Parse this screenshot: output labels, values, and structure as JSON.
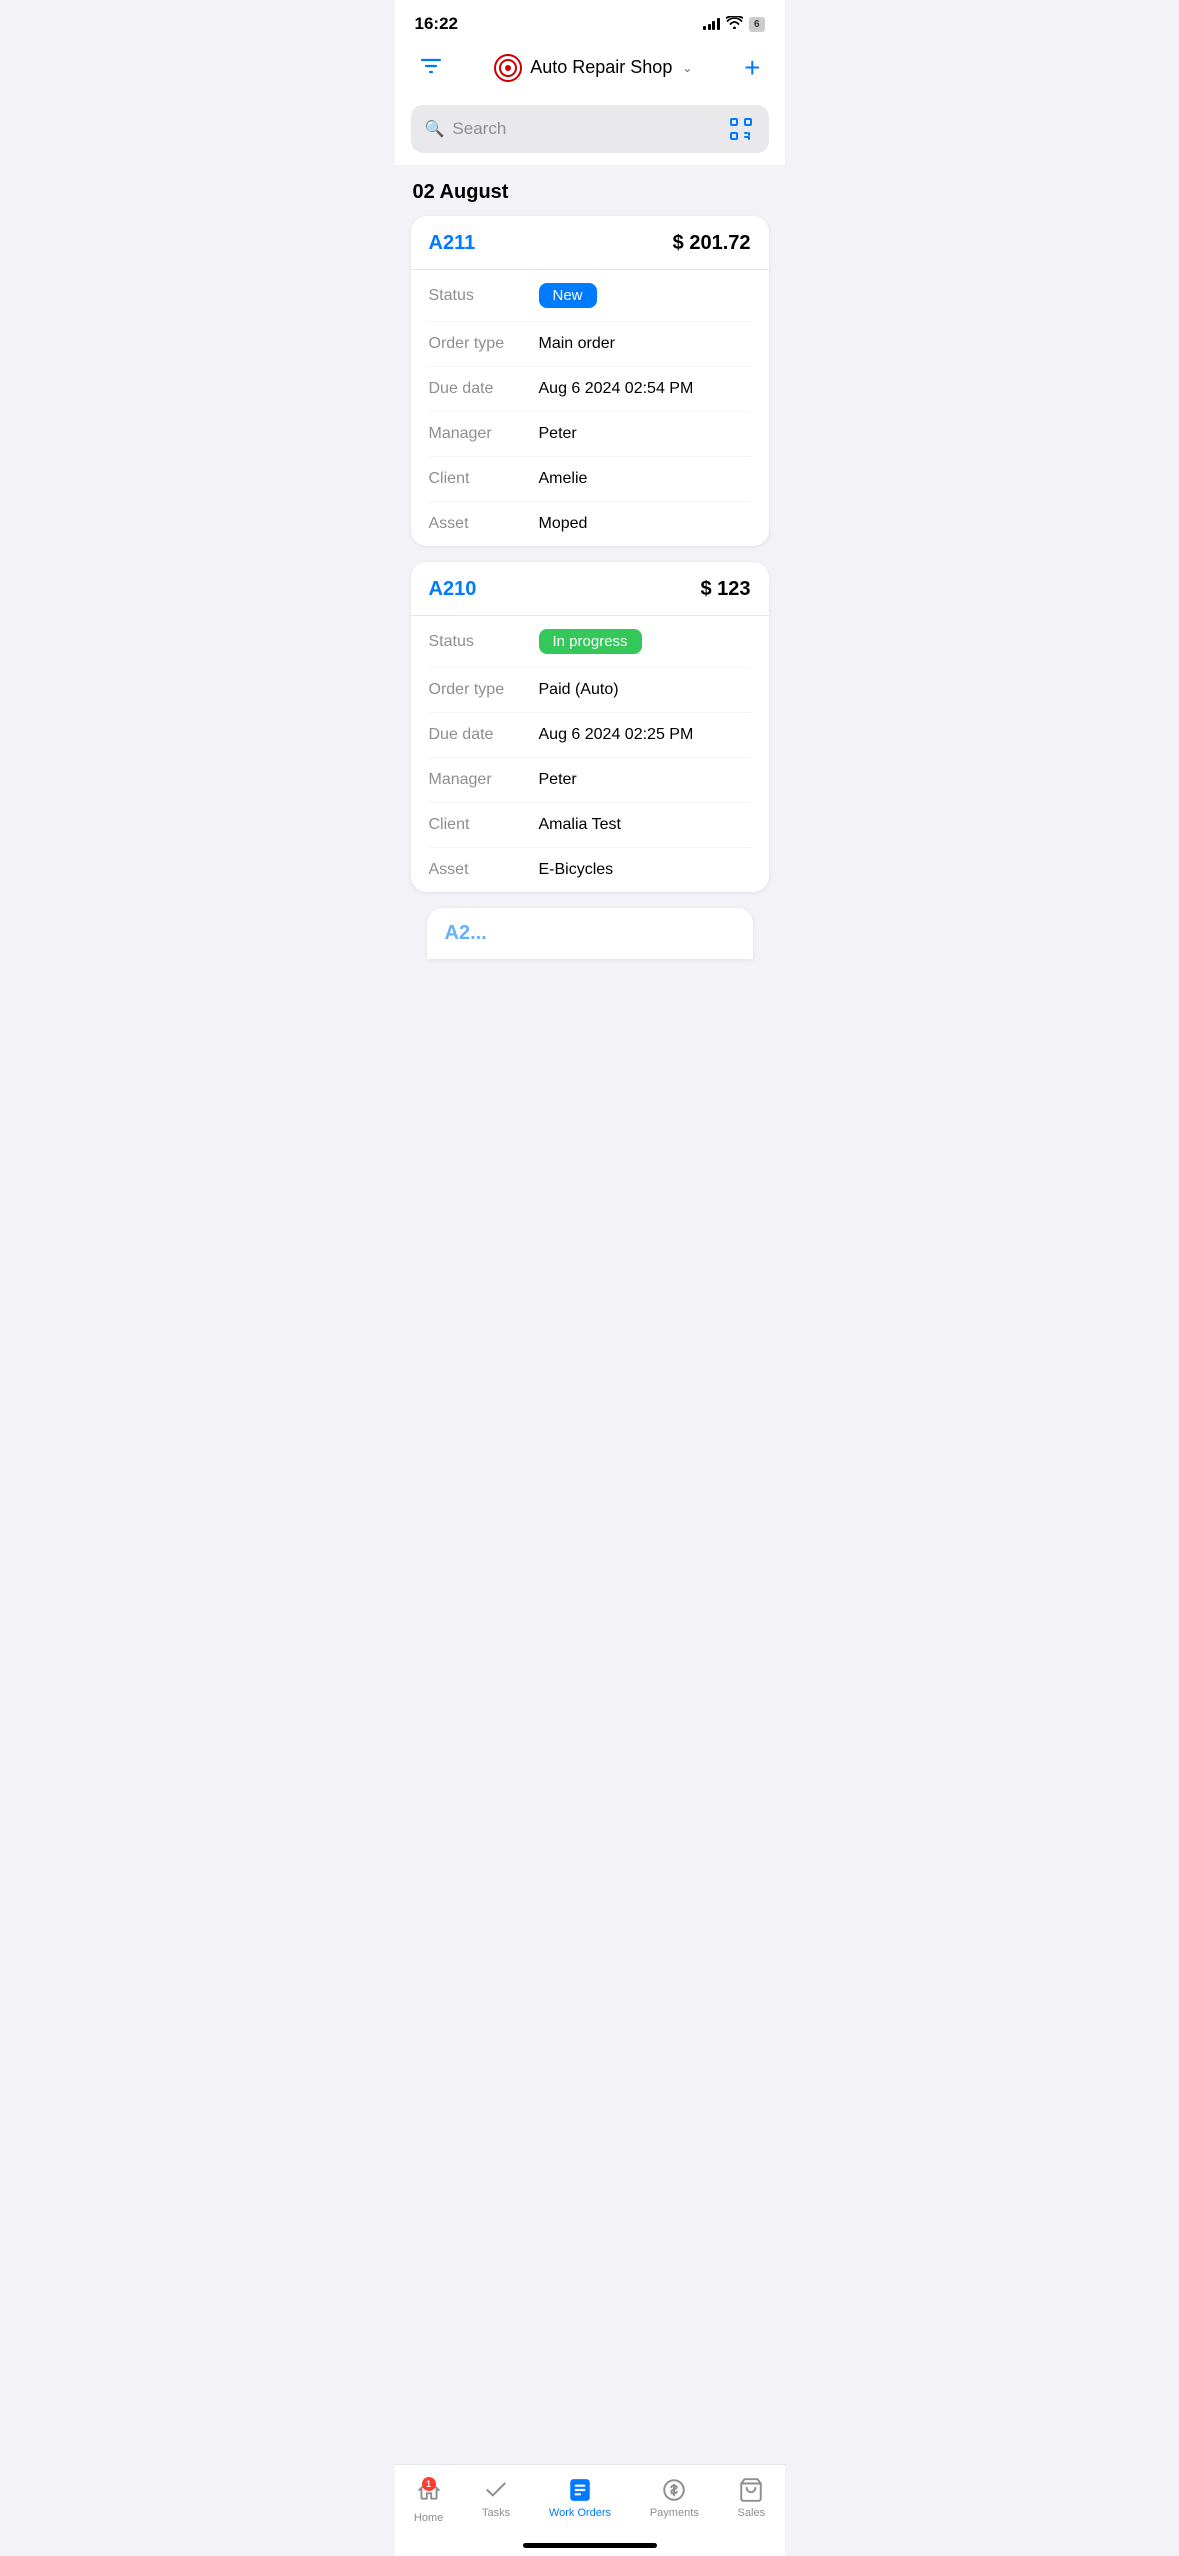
{
  "statusBar": {
    "time": "16:22",
    "battery": "6"
  },
  "header": {
    "shopName": "Auto Repair Shop",
    "filterLabel": "filter",
    "addLabel": "add"
  },
  "search": {
    "placeholder": "Search"
  },
  "dateSection": {
    "date": "02 August"
  },
  "orders": [
    {
      "id": "A211",
      "amount": "$ 201.72",
      "status": "New",
      "statusType": "new",
      "orderTypeLabel": "Order type",
      "orderTypeValue": "Main order",
      "dueDateLabel": "Due date",
      "dueDateValue": "Aug 6 2024 02:54 PM",
      "managerLabel": "Manager",
      "managerValue": "Peter",
      "clientLabel": "Client",
      "clientValue": "Amelie",
      "assetLabel": "Asset",
      "assetValue": "Moped"
    },
    {
      "id": "A210",
      "amount": "$ 123",
      "status": "In progress",
      "statusType": "in-progress",
      "orderTypeLabel": "Order type",
      "orderTypeValue": "Paid (Auto)",
      "dueDateLabel": "Due date",
      "dueDateValue": "Aug 6 2024 02:25 PM",
      "managerLabel": "Manager",
      "managerValue": "Peter",
      "clientLabel": "Client",
      "clientValue": "Amalia Test",
      "assetLabel": "Asset",
      "assetValue": "E-Bicycles"
    }
  ],
  "partialOrder": {
    "id": "A2..."
  },
  "bottomNav": {
    "items": [
      {
        "id": "home",
        "label": "Home",
        "active": false,
        "badge": "1"
      },
      {
        "id": "tasks",
        "label": "Tasks",
        "active": false,
        "badge": ""
      },
      {
        "id": "work-orders",
        "label": "Work Orders",
        "active": true,
        "badge": ""
      },
      {
        "id": "payments",
        "label": "Payments",
        "active": false,
        "badge": ""
      },
      {
        "id": "sales",
        "label": "Sales",
        "active": false,
        "badge": ""
      }
    ]
  }
}
